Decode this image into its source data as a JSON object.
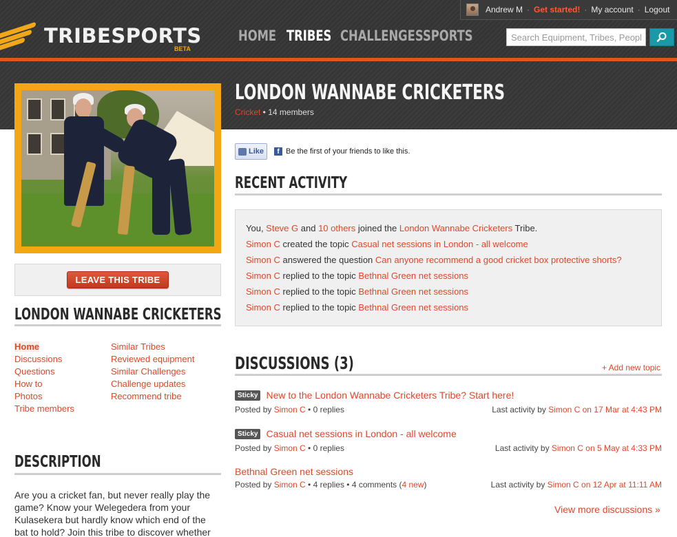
{
  "account": {
    "user": "Andrew M",
    "get_started": "Get started!",
    "my_account": "My account",
    "logout": "Logout",
    "sep": "·"
  },
  "header": {
    "brand": "TRIBESPORTS",
    "beta": "BETA",
    "nav": [
      "HOME",
      "TRIBES",
      "CHALLENGES",
      "SPORTS"
    ],
    "active_nav": "TRIBES",
    "search_placeholder": "Search Equipment, Tribes, People",
    "accent": "#e0561e",
    "search_btn_color": "#1a9aa8"
  },
  "tribe": {
    "title": "LONDON WANNABE CRICKETERS",
    "sport": "Cricket",
    "members": " • 14 members",
    "leave_button": "LEAVE THIS TRIBE"
  },
  "facebook": {
    "like": "Like",
    "text": "Be the first of your friends to like this."
  },
  "left": {
    "heading": "LONDON WANNABE CRICKETERS",
    "links_col1": [
      "Home",
      "Discussions",
      "Questions",
      "How to",
      "Photos",
      "Tribe members"
    ],
    "links_col2": [
      "Similar Tribes",
      "Reviewed equipment",
      "Similar Challenges",
      "Challenge updates",
      "Recommend tribe"
    ],
    "description_heading": "DESCRIPTION",
    "description": "Are you a cricket fan, but never really play the game? Know your Welegedera from your Kulasekera but hardly know which end of the bat to hold? Join this tribe to discover whether"
  },
  "recent": {
    "heading": "RECENT ACTIVITY",
    "items": [
      {
        "pre": "You, ",
        "a1": "Steve G",
        "mid": " and ",
        "a2": "10 others",
        "mid2": " joined the ",
        "a3": "London Wannabe Cricketers",
        "post": " Tribe."
      },
      {
        "a1": "Simon C",
        "mid": " created the topic ",
        "a2": "Casual net sessions in London - all welcome"
      },
      {
        "a1": "Simon C",
        "mid": " answered the question ",
        "a2": "Can anyone recommend a good cricket box protective shorts?"
      },
      {
        "a1": "Simon C",
        "mid": " replied to the topic ",
        "a2": "Bethnal Green net sessions"
      },
      {
        "a1": "Simon C",
        "mid": " replied to the topic ",
        "a2": "Bethnal Green net sessions"
      },
      {
        "a1": "Simon C",
        "mid": " replied to the topic ",
        "a2": "Bethnal Green net sessions"
      }
    ]
  },
  "discussions": {
    "heading": "DISCUSSIONS (3)",
    "add_topic": "+ Add new topic",
    "sticky_label": "Sticky",
    "posted_by": "Posted by ",
    "last_activity": "Last activity by ",
    "items": [
      {
        "title": "New to the London Wannabe Cricketers Tribe? Start here!",
        "author": "Simon C",
        "stats": " • 0 replies",
        "last": "Simon C on 17 Mar at 4:43 PM",
        "sticky": true
      },
      {
        "title": "Casual net sessions in London - all welcome",
        "author": "Simon C",
        "stats": " • 0 replies",
        "last": "Simon C on 5 May at 4:33 PM",
        "sticky": true
      },
      {
        "title": "Bethnal Green net sessions",
        "author": "Simon C",
        "stats": " • 4 replies • 4 comments (",
        "new": "4 new",
        "stats_end": ")",
        "last": "Simon C on 12 Apr at 11:11 AM",
        "sticky": false
      }
    ],
    "view_more": "View more discussions »"
  }
}
